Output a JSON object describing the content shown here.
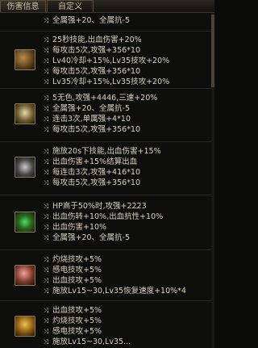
{
  "tabs": [
    "伤害信息",
    "自定义"
  ],
  "icon_names": [
    "emerald-gauntlet-icon",
    "golden-ring-icon",
    "steel-bracer-icon",
    "green-gem-ring-icon",
    "pink-charm-icon",
    "gold-flask-icon"
  ],
  "groups": [
    {
      "lines": [
        "全属强+20、全属抗-5"
      ]
    },
    {
      "lines": [
        "25秒技能,出血伤害+20%",
        "每攻击5次,攻强+356*10",
        "Lv40冷却+15%,Lv35技攻+20%",
        "每攻击5次,攻强+356*10",
        "Lv35冷却+15%,Lv35技攻+20%"
      ]
    },
    {
      "lines": [
        "5无色,攻强+4446,三速+20%",
        "全属强+20、全属抗-5",
        "连击3次,单属强+4*10",
        "每攻击5次,攻强+356*10"
      ]
    },
    {
      "lines": [
        "施放20s下技能,出血伤害+15%",
        "出血伤害+15%结算出血",
        "每连击3次,攻强+416*10",
        "每攻击5次,攻强+356*10"
      ]
    },
    {
      "lines": [
        "HP高于50%时,攻强+2223",
        "出血伤转+10%,出血抗性+10%",
        "出血伤害+10%",
        "全属强+20、全属抗-5"
      ]
    },
    {
      "lines": [
        "灼烧技攻+5%",
        "感电技攻+5%",
        "出血技攻+5%",
        "施放Lv15~30,Lv35恢复速度+10%*4"
      ]
    },
    {
      "lines": [
        "出血技攻+5%",
        "灼烧技攻+5%",
        "感电技攻+5%",
        "施放Lv15~30,Lv35..."
      ]
    }
  ]
}
